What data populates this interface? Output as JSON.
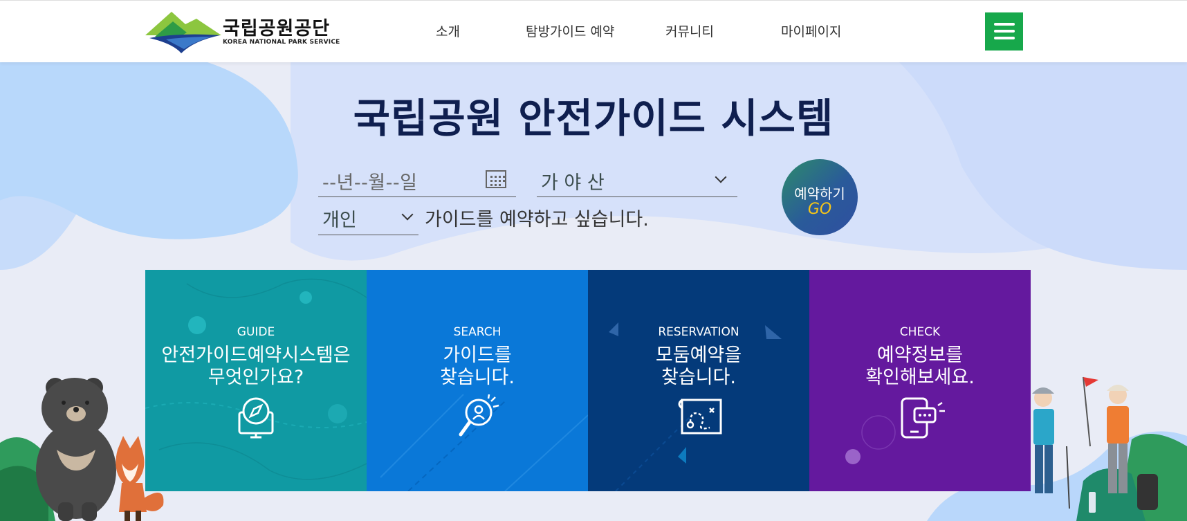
{
  "header": {
    "logo_ko": "국립공원공단",
    "logo_en": "KOREA NATIONAL PARK SERVICE",
    "nav": [
      "소개",
      "탐방가이드 예약",
      "커뮤니티",
      "마이페이지"
    ]
  },
  "hero": {
    "title": "국립공원 안전가이드 시스템",
    "date_placeholder": "--년--월--일",
    "park_selected": "가 야 산",
    "type_selected": "개인",
    "sentence": "가이드를 예약하고 싶습니다.",
    "go_label": "예약하기",
    "go_sub": "GO"
  },
  "cards": [
    {
      "en": "GUIDE",
      "ko1": "안전가이드예약시스템은",
      "ko2": "무엇인가요?",
      "color": "#109aa3",
      "icon": "monitor-compass-icon"
    },
    {
      "en": "SEARCH",
      "ko1": "가이드를",
      "ko2": "찾습니다.",
      "color": "#0a78d8",
      "icon": "magnifier-person-icon"
    },
    {
      "en": "RESERVATION",
      "ko1": "모둠예약을",
      "ko2": "찾습니다.",
      "color": "#043a7a",
      "icon": "trail-map-icon"
    },
    {
      "en": "CHECK",
      "ko1": "예약정보를",
      "ko2": "확인해보세요.",
      "color": "#64199e",
      "icon": "phone-chat-icon"
    }
  ],
  "colors": {
    "brand_green": "#17a84b",
    "title_navy": "#0f1f4f",
    "go_text": "#f5c518"
  }
}
